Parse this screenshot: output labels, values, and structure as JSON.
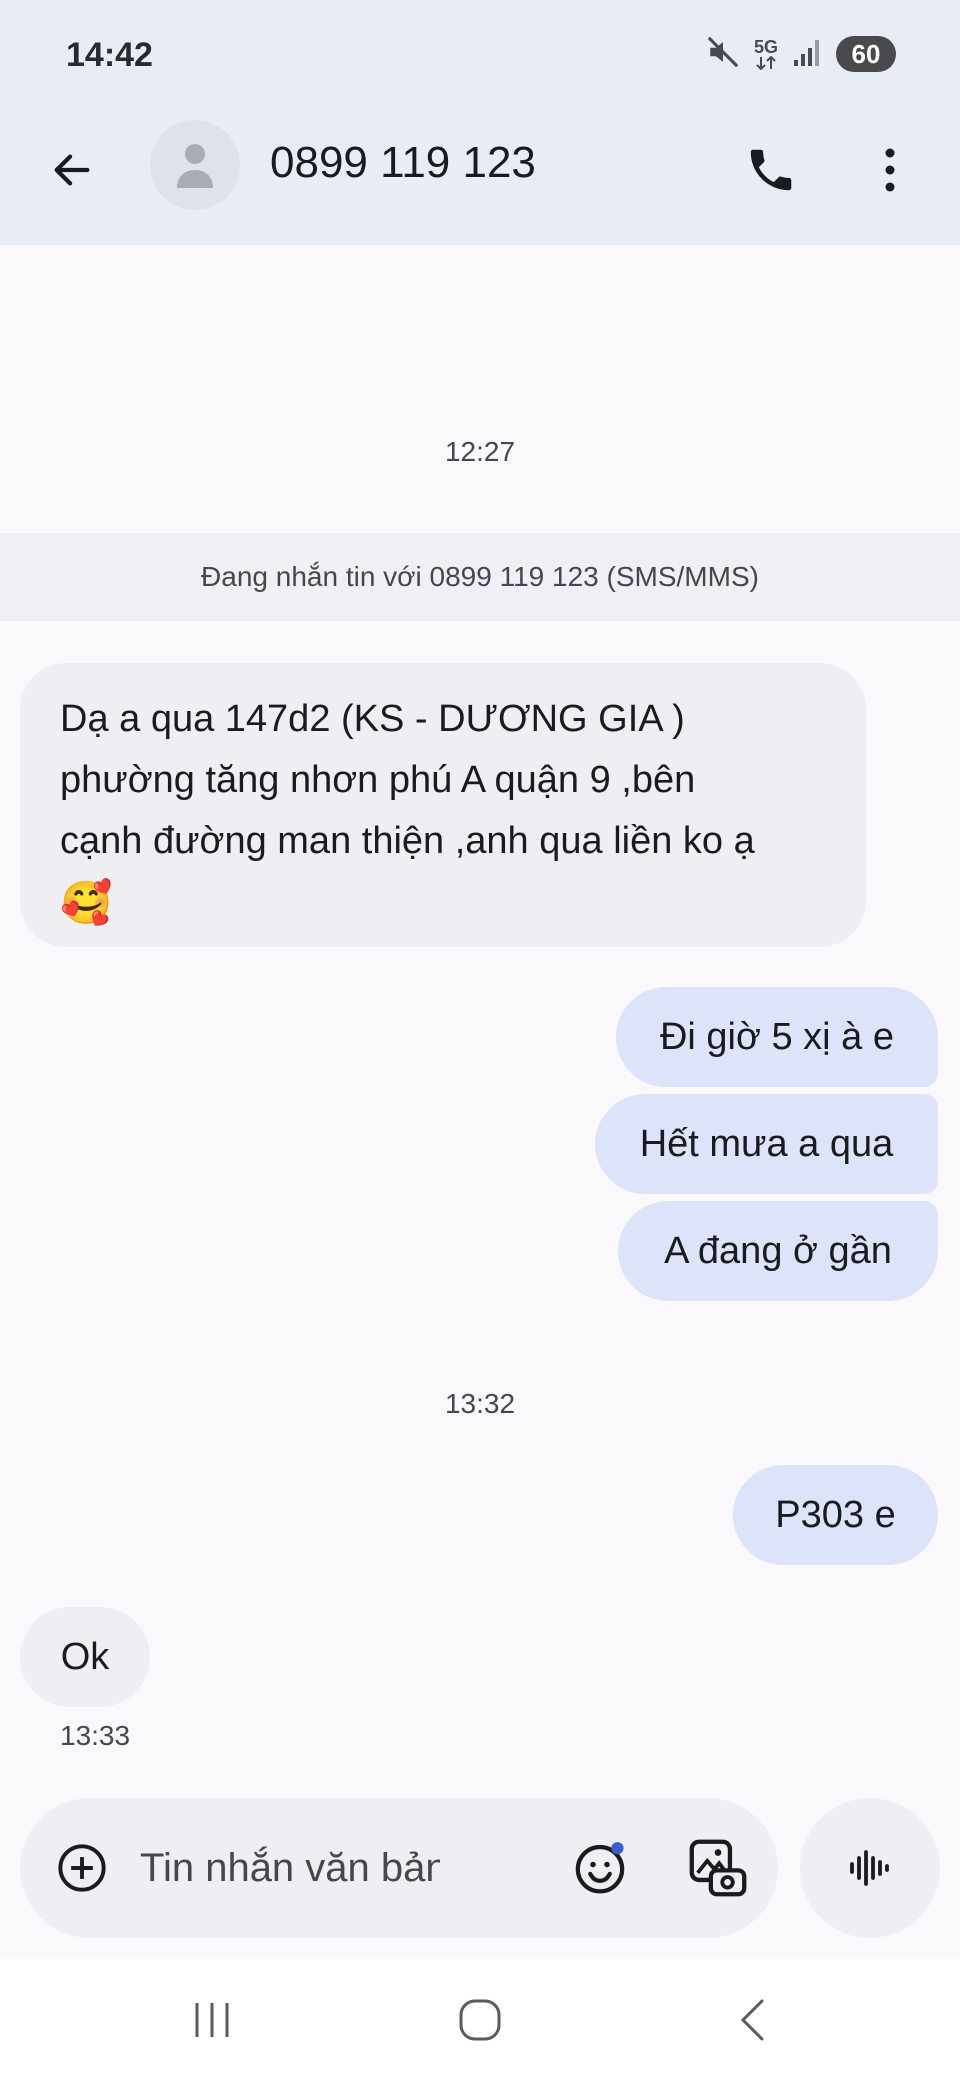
{
  "status_bar": {
    "time": "14:42",
    "network": "5G",
    "battery": "60"
  },
  "header": {
    "contact": "0899 119 123"
  },
  "conversation": {
    "timestamp_1": "12:27",
    "banner": "Đang nhắn tin với 0899 119 123 (SMS/MMS)",
    "incoming_1": {
      "lines": [
        "Dạ a qua 147d2 (KS - DƯƠNG GIA )",
        "phường tăng nhơn phú A quận 9 ,bên",
        "cạnh đường man thiện ,anh qua liền ko ạ"
      ],
      "emoji": "🥰"
    },
    "outgoing_1": "Đi giờ 5 xị à e",
    "outgoing_2": "Hết mưa a qua",
    "outgoing_3": "A đang ở gần",
    "timestamp_2": "13:32",
    "outgoing_4": "P303 e",
    "incoming_2": "Ok",
    "incoming_2_time": "13:33"
  },
  "composer": {
    "placeholder": "Tin nhắn văn bản"
  },
  "icons": {
    "back": "arrow-left-icon",
    "avatar": "person-icon",
    "call": "phone-icon",
    "more": "more-vertical-icon",
    "add": "plus-circle-icon",
    "emoji": "emoji-icon",
    "media": "gallery-icon",
    "voice": "waveform-icon"
  },
  "colors": {
    "header_bg": "#e8ecf4",
    "incoming_bubble": "#eeeef3",
    "outgoing_bubble": "#dde3f8",
    "accent": "#3b5bd0"
  }
}
